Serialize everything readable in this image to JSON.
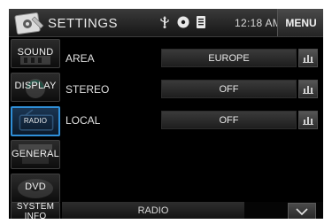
{
  "header": {
    "title": "SETTINGS",
    "time": "12:18 AM",
    "menu_label": "MENU",
    "status_icons": [
      "usb-icon",
      "disc-icon",
      "sd-card-icon"
    ]
  },
  "sidebar": {
    "items": [
      {
        "label": "SOUND",
        "icon": "sound-icon",
        "active": false
      },
      {
        "label": "DISPLAY",
        "icon": "display-icon",
        "active": false
      },
      {
        "label": "RADIO",
        "icon": "radio-icon",
        "active": true
      },
      {
        "label": "GENERAL",
        "icon": "general-icon",
        "active": false
      },
      {
        "label": "DVD",
        "icon": "dvd-icon",
        "active": false
      },
      {
        "label": "SYSTEM INFO",
        "icon": "system-info-icon",
        "active": false
      }
    ]
  },
  "settings": {
    "rows": [
      {
        "label": "AREA",
        "value": "EUROPE"
      },
      {
        "label": "STEREO",
        "value": "OFF"
      },
      {
        "label": "LOCAL",
        "value": "OFF"
      }
    ]
  },
  "footer": {
    "source_label": "RADIO"
  },
  "colors": {
    "accent": "#2f8fd8",
    "background": "#000000",
    "text": "#e8e8e8"
  }
}
